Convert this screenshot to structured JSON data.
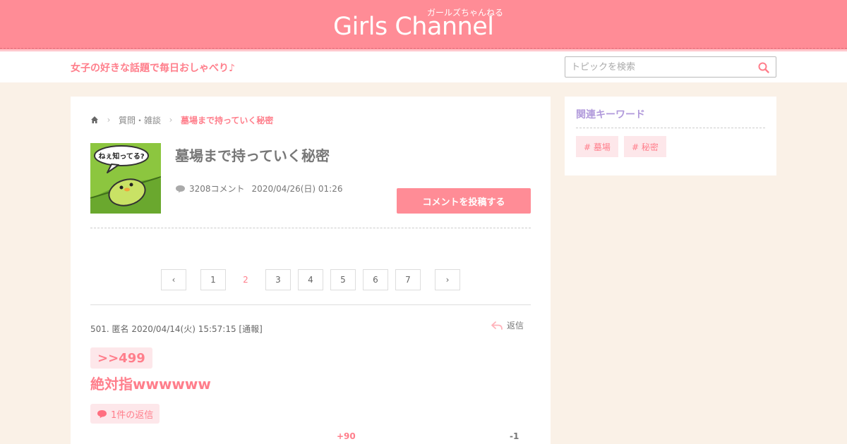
{
  "header": {
    "logo": "Girls Channel",
    "logo_ruby": "ガールズちゃんねる",
    "tagline": "女子の好きな話題で毎日おしゃべり♪",
    "search_placeholder": "トピックを検索"
  },
  "breadcrumb": {
    "category": "質問・雑談",
    "current": "墓場まで持っていく秘密"
  },
  "topic": {
    "thumb_text": "ねぇ知ってる?",
    "title": "墓場まで持っていく秘密",
    "comment_count": "3208コメント",
    "date": "2020/04/26(日) 01:26",
    "post_button": "コメントを投稿する"
  },
  "pagination": {
    "prev": "‹",
    "next": "›",
    "pages": [
      "1",
      "2",
      "3",
      "4",
      "5",
      "6",
      "7"
    ],
    "current": "2"
  },
  "comment": {
    "meta": "501. 匿名 2020/04/14(火) 15:57:15 [通報]",
    "reply_label": "返信",
    "anchor": ">>499",
    "body": "絶対指wwwwww",
    "replies": "1件の返信",
    "plus": "+90",
    "minus": "-1"
  },
  "sidebar": {
    "title": "関連キーワード",
    "keywords": [
      "# 墓場",
      "# 秘密"
    ]
  },
  "colors": {
    "brand_pink": "#ff8c96",
    "accent_text": "#ff7e8b",
    "sidebar_title": "#b19adb",
    "background": "#faf1e7"
  }
}
